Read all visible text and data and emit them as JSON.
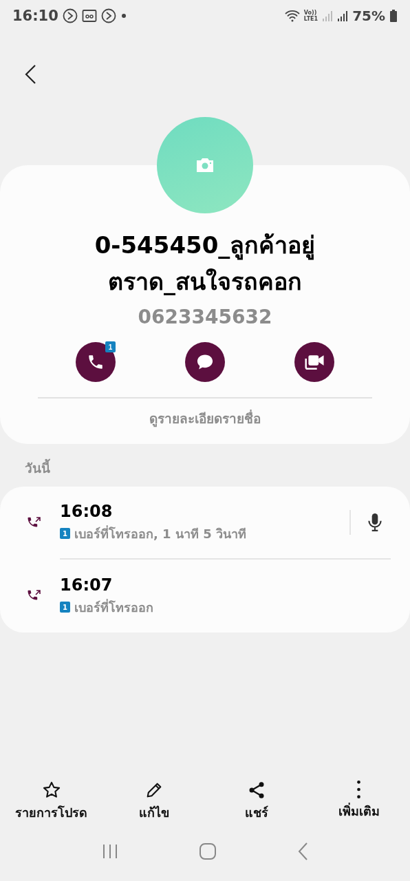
{
  "status_bar": {
    "time": "16:10",
    "volte_label": "Vo))",
    "lte_label": "LTE1",
    "battery": "75%"
  },
  "contact": {
    "name_lines": [
      "0-545450_ลูกค้าอยู่",
      "ตราด_สนใจรถคอก"
    ],
    "phone": "0623345632",
    "actions": [
      {
        "kind": "call",
        "badge": "1"
      },
      {
        "kind": "message"
      },
      {
        "kind": "video"
      }
    ],
    "details_link": "ดูรายละเอียดรายชื่อ"
  },
  "section_title": "วันนี้",
  "calls": [
    {
      "time": "16:08",
      "sim": "1",
      "description": "เบอร์ที่โทรออก, 1 นาที 5 วินาที",
      "has_recording": true
    },
    {
      "time": "16:07",
      "sim": "1",
      "description": "เบอร์ที่โทรออก",
      "has_recording": false
    }
  ],
  "bottom_actions": [
    {
      "kind": "star",
      "label": "รายการโปรด"
    },
    {
      "kind": "edit",
      "label": "แก้ไข"
    },
    {
      "kind": "share",
      "label": "แชร์"
    },
    {
      "kind": "more",
      "label": "เพิ่มเติม"
    }
  ]
}
